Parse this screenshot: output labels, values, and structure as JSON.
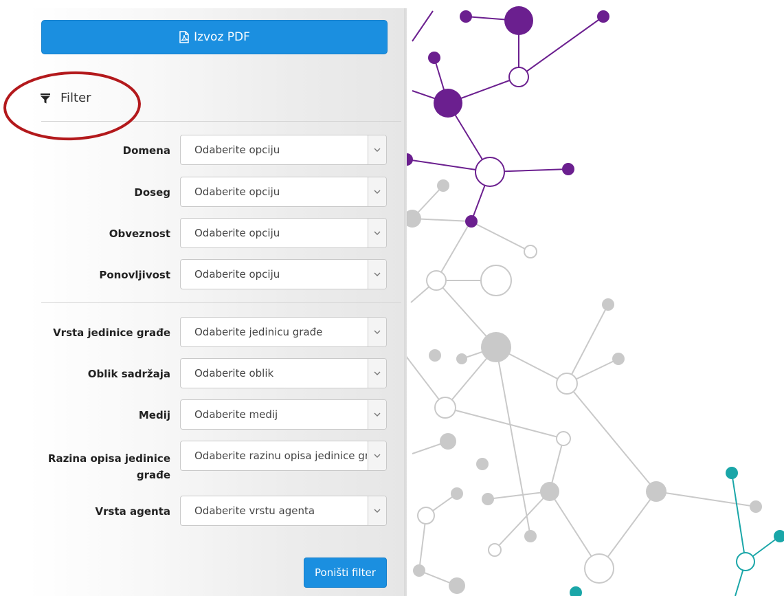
{
  "export": {
    "label": "Izvoz PDF",
    "icon": "pdf-file-icon"
  },
  "filter": {
    "title": "Filter",
    "icon": "funnel-icon"
  },
  "groups": [
    [
      {
        "label": "Domena",
        "placeholder": "Odaberite opciju"
      },
      {
        "label": "Doseg",
        "placeholder": "Odaberite opciju"
      },
      {
        "label": "Obveznost",
        "placeholder": "Odaberite opciju"
      },
      {
        "label": "Ponovljivost",
        "placeholder": "Odaberite opciju"
      }
    ],
    [
      {
        "label": "Vrsta jedinice građe",
        "placeholder": "Odaberite jedinicu građe"
      },
      {
        "label": "Oblik sadržaja",
        "placeholder": "Odaberite oblik"
      },
      {
        "label": "Medij",
        "placeholder": "Odaberite medij"
      },
      {
        "label": "Razina opisa jedinice građe",
        "placeholder": "Odaberite razinu opisa jedinice građe"
      },
      {
        "label": "Vrsta agenta",
        "placeholder": "Odaberite vrstu agenta"
      }
    ]
  ],
  "reset": {
    "label": "Poništi filter"
  },
  "colors": {
    "primary": "#1b8fe0",
    "annotation": "#b3191c",
    "network_purple": "#6b1f8f",
    "network_gray": "#c6c6c6",
    "network_teal": "#1aa6a8"
  }
}
